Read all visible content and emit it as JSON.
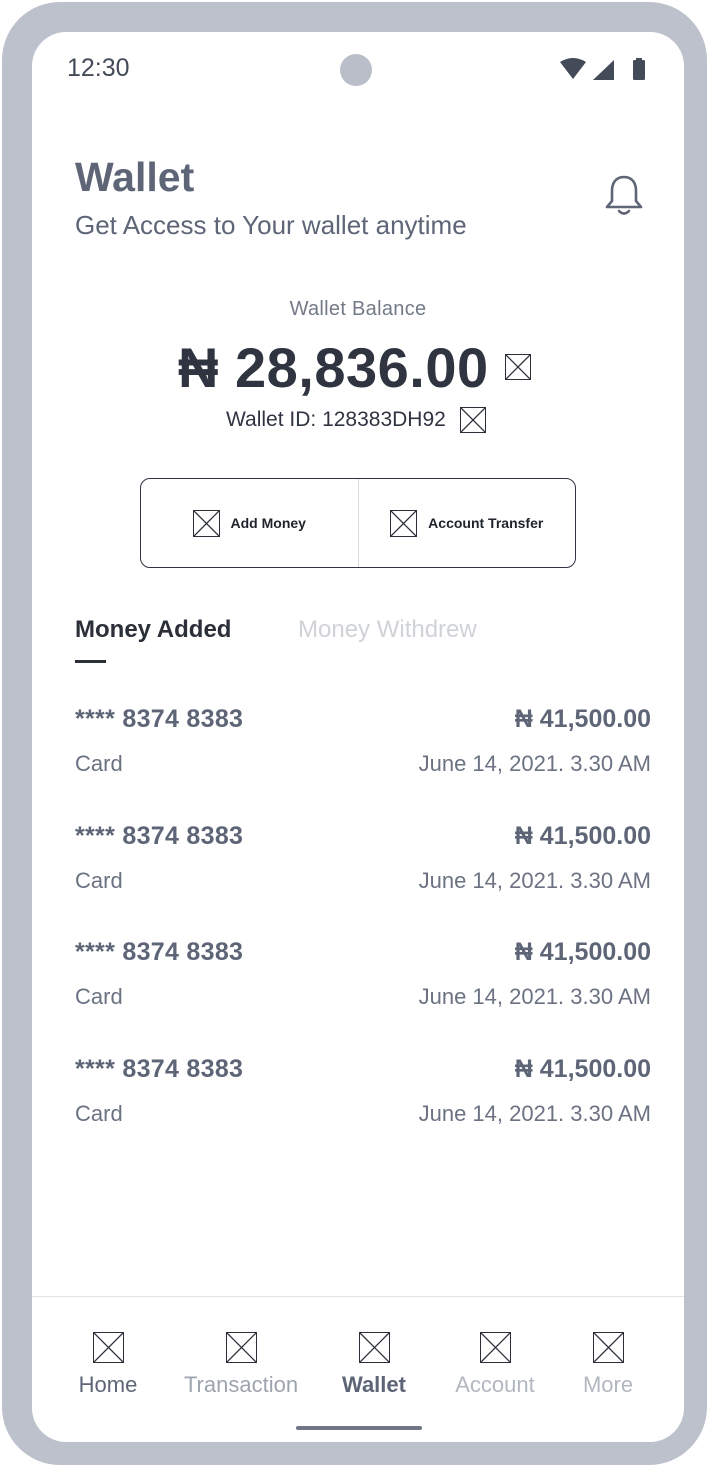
{
  "status_bar": {
    "time": "12:30",
    "icons": [
      "wifi-icon",
      "signal-icon",
      "battery-icon"
    ]
  },
  "header": {
    "title": "Wallet",
    "subtitle": "Get Access to Your wallet anytime",
    "icon": "bell-icon"
  },
  "balance": {
    "label": "Wallet Balance",
    "amount": "₦ 28,836.00",
    "wallet_id": "Wallet ID: 128383DH92"
  },
  "actions": [
    {
      "label": "Add Money",
      "icon": "placeholder-image-icon"
    },
    {
      "label": "Account Transfer",
      "icon": "placeholder-image-icon"
    }
  ],
  "tabs": [
    {
      "label": "Money Added",
      "active": true
    },
    {
      "label": "Money Withdrew",
      "active": false
    }
  ],
  "transactions": [
    {
      "card": "**** 8374 8383",
      "amount": "₦ 41,500.00",
      "method": "Card",
      "date": "June 14, 2021.  3.30 AM"
    },
    {
      "card": "**** 8374 8383",
      "amount": "₦ 41,500.00",
      "method": "Card",
      "date": "June 14, 2021.  3.30 AM"
    },
    {
      "card": "**** 8374 8383",
      "amount": "₦ 41,500.00",
      "method": "Card",
      "date": "June 14, 2021.  3.30 AM"
    },
    {
      "card": "**** 8374 8383",
      "amount": "₦ 41,500.00",
      "method": "Card",
      "date": "June 14, 2021.  3.30 AM"
    }
  ],
  "bottom_nav": [
    {
      "label": "Home",
      "active": false
    },
    {
      "label": "Transaction",
      "active": false
    },
    {
      "label": "Wallet",
      "active": true
    },
    {
      "label": "Account",
      "active": false
    },
    {
      "label": "More",
      "active": false
    }
  ],
  "colors": {
    "frame": "#bcc1cb",
    "primary_text": "#5d6577",
    "dark_text": "#2f3440",
    "inactive": "#b2b7c0"
  }
}
